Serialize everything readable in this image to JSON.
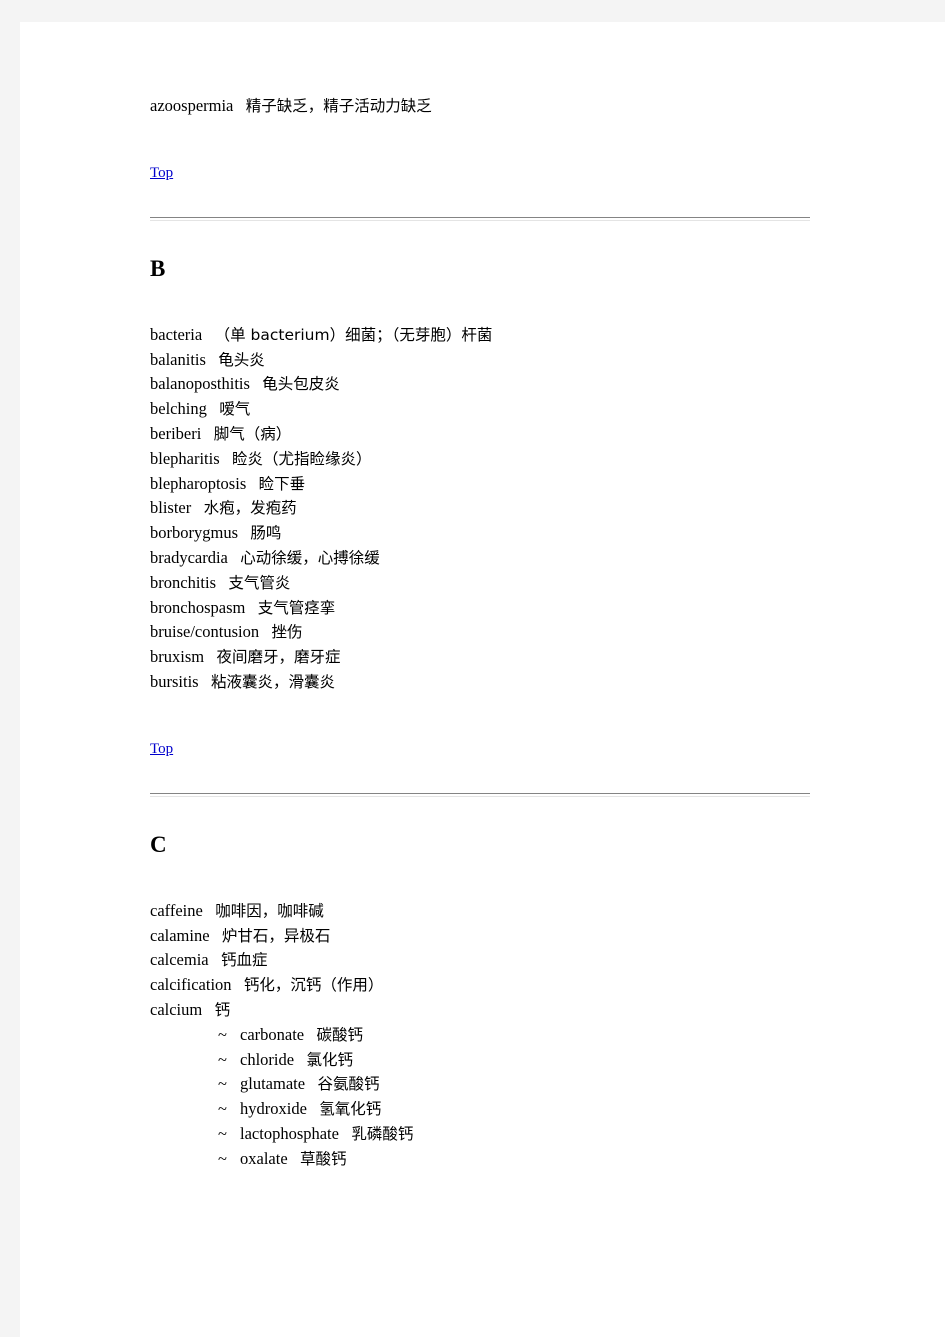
{
  "document": {
    "top_link_label": "Top"
  },
  "sections": [
    {
      "letter": "",
      "entries": [
        {
          "term": "azoospermia",
          "gloss": "精子缺乏，精子活动力缺乏"
        }
      ],
      "sub_entries": []
    },
    {
      "letter": "B",
      "entries": [
        {
          "term": "bacteria",
          "gloss": "（单 bacterium）细菌；（无芽胞）杆菌"
        },
        {
          "term": "balanitis",
          "gloss": "龟头炎"
        },
        {
          "term": "balanoposthitis",
          "gloss": "龟头包皮炎"
        },
        {
          "term": "belching",
          "gloss": "嗳气"
        },
        {
          "term": "beriberi",
          "gloss": "脚气（病）"
        },
        {
          "term": "blepharitis",
          "gloss": "睑炎（尤指睑缘炎）"
        },
        {
          "term": "blepharoptosis",
          "gloss": "睑下垂"
        },
        {
          "term": "blister",
          "gloss": "水疱，发疱药"
        },
        {
          "term": "borborygmus",
          "gloss": "肠鸣"
        },
        {
          "term": "bradycardia",
          "gloss": "心动徐缓，心搏徐缓"
        },
        {
          "term": "bronchitis",
          "gloss": "支气管炎"
        },
        {
          "term": "bronchospasm",
          "gloss": "支气管痉挛"
        },
        {
          "term": "bruise/contusion",
          "gloss": "挫伤"
        },
        {
          "term": "bruxism",
          "gloss": "夜间磨牙，磨牙症"
        },
        {
          "term": "bursitis",
          "gloss": "粘液囊炎，滑囊炎"
        }
      ],
      "sub_entries": []
    },
    {
      "letter": "C",
      "entries": [
        {
          "term": "caffeine",
          "gloss": "咖啡因，咖啡碱"
        },
        {
          "term": "calamine",
          "gloss": "炉甘石，异极石"
        },
        {
          "term": "calcemia",
          "gloss": "钙血症"
        },
        {
          "term": "calcification",
          "gloss": "钙化，沉钙（作用）"
        },
        {
          "term": "calcium",
          "gloss": "钙"
        }
      ],
      "sub_entries": [
        {
          "marker": "~",
          "term": "carbonate",
          "gloss": "碳酸钙"
        },
        {
          "marker": "~",
          "term": "chloride",
          "gloss": "氯化钙"
        },
        {
          "marker": "~",
          "term": "glutamate",
          "gloss": "谷氨酸钙"
        },
        {
          "marker": "~",
          "term": "hydroxide",
          "gloss": "氢氧化钙"
        },
        {
          "marker": "~",
          "term": "lactophosphate",
          "gloss": "乳磷酸钙"
        },
        {
          "marker": "~",
          "term": "oxalate",
          "gloss": "草酸钙"
        }
      ]
    }
  ]
}
